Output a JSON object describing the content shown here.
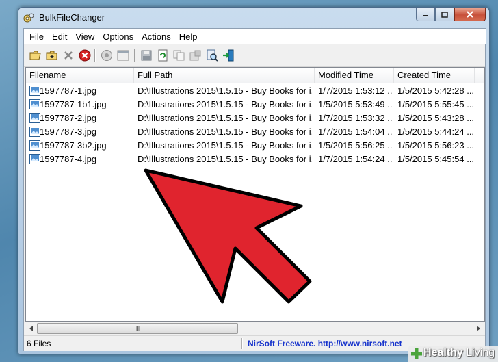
{
  "window": {
    "title": "BulkFileChanger",
    "app_icon": "gear-cluster-icon",
    "minimize_icon": "minimize-icon",
    "maximize_icon": "maximize-icon",
    "close_icon": "close-icon"
  },
  "menu": {
    "items": [
      {
        "label": "File"
      },
      {
        "label": "Edit"
      },
      {
        "label": "View"
      },
      {
        "label": "Options"
      },
      {
        "label": "Actions"
      },
      {
        "label": "Help"
      }
    ]
  },
  "toolbar": {
    "buttons": [
      {
        "icon": "open-folder-icon"
      },
      {
        "icon": "add-files-icon"
      },
      {
        "icon": "remove-cross-icon"
      },
      {
        "icon": "clear-all-icon"
      },
      {
        "icon": "properties-icon"
      },
      {
        "icon": "window-icon"
      },
      {
        "icon": "save-icon"
      },
      {
        "icon": "refresh-icon"
      },
      {
        "icon": "copy-icon"
      },
      {
        "icon": "properties-html-icon"
      },
      {
        "icon": "search-file-icon"
      },
      {
        "icon": "exit-icon"
      }
    ]
  },
  "table": {
    "columns": [
      "Filename",
      "Full Path",
      "Modified Time",
      "Created Time"
    ],
    "rows": [
      {
        "filename": "1597787-1.jpg",
        "path": "D:\\Illustrations 2015\\1.5.15 - Buy Books for i...",
        "modified": "1/7/2015 1:53:12 ...",
        "created": "1/5/2015 5:42:28 ..."
      },
      {
        "filename": "1597787-1b1.jpg",
        "path": "D:\\Illustrations 2015\\1.5.15 - Buy Books for i...",
        "modified": "1/5/2015 5:53:49 ...",
        "created": "1/5/2015 5:55:45 ..."
      },
      {
        "filename": "1597787-2.jpg",
        "path": "D:\\Illustrations 2015\\1.5.15 - Buy Books for i...",
        "modified": "1/7/2015 1:53:32 ...",
        "created": "1/5/2015 5:43:28 ..."
      },
      {
        "filename": "1597787-3.jpg",
        "path": "D:\\Illustrations 2015\\1.5.15 - Buy Books for i...",
        "modified": "1/7/2015 1:54:04 ...",
        "created": "1/5/2015 5:44:24 ..."
      },
      {
        "filename": "1597787-3b2.jpg",
        "path": "D:\\Illustrations 2015\\1.5.15 - Buy Books for i...",
        "modified": "1/5/2015 5:56:25 ...",
        "created": "1/5/2015 5:56:23 ..."
      },
      {
        "filename": "1597787-4.jpg",
        "path": "D:\\Illustrations 2015\\1.5.15 - Buy Books for i...",
        "modified": "1/7/2015 1:54:24 ...",
        "created": "1/5/2015 5:45:54 ..."
      }
    ],
    "row_icon": "image-file-icon"
  },
  "scrollbar": {
    "thumb_grip": "III",
    "left_icon": "scroll-left-icon",
    "right_icon": "scroll-right-icon"
  },
  "status": {
    "count": "6 Files",
    "link": "NirSoft Freeware.  http://www.nirsoft.net"
  },
  "overlay": {
    "arrow_icon": "pointer-arrow-icon",
    "arrow_color": "#e0242e"
  },
  "watermark": {
    "brand_strong": "Healthy",
    "brand_light": " Living",
    "icon": "plus-cross-icon"
  }
}
